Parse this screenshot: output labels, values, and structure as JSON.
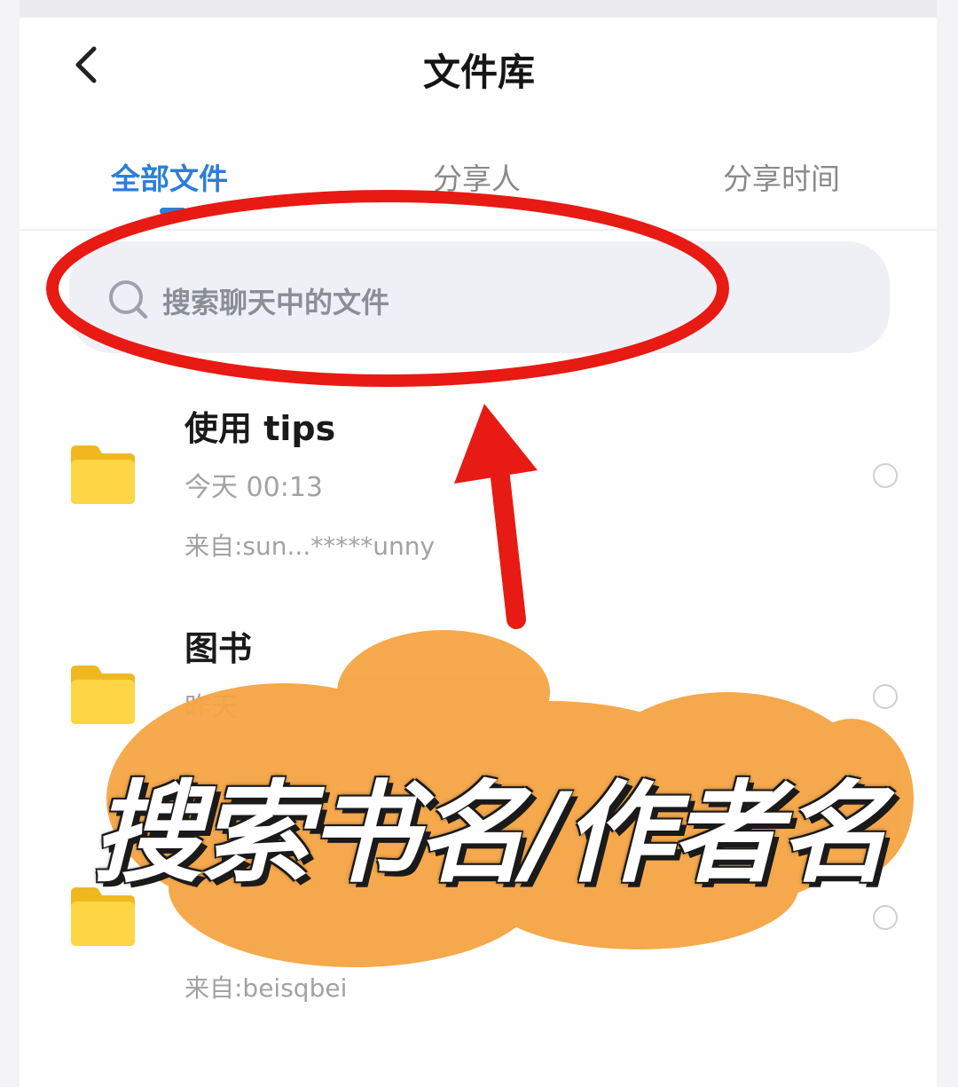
{
  "header": {
    "title": "文件库"
  },
  "tabs": [
    {
      "label": "全部文件"
    },
    {
      "label": "分享人"
    },
    {
      "label": "分享时间"
    }
  ],
  "search": {
    "placeholder": "搜索聊天中的文件"
  },
  "files": [
    {
      "name": "使用 tips",
      "time": "今天 00:13",
      "from": "来自:sun...*****unny"
    },
    {
      "name": "图书",
      "time": "昨天",
      "from": ""
    },
    {
      "name": "",
      "time": "",
      "from": "来自:beisqbei"
    }
  ],
  "annotation": {
    "caption": "搜索书名/作者名"
  },
  "colors": {
    "accent": "#2a7fd7",
    "folder": "#f6c533",
    "marker_red": "#e81a14",
    "highlight_orange": "#f5a443"
  }
}
